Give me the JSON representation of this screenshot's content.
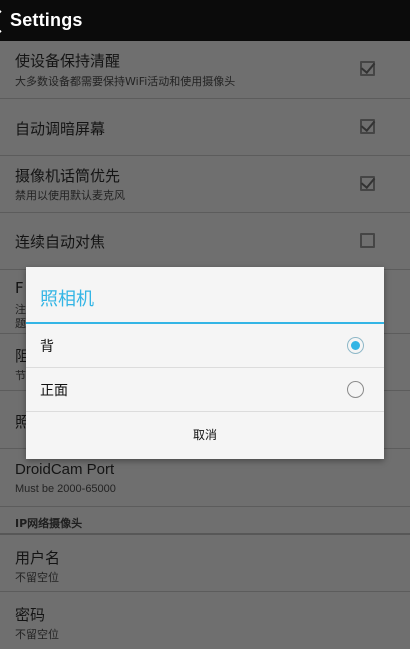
{
  "actionbar": {
    "title": "Settings"
  },
  "settings": {
    "keep_awake": {
      "title": "使设备保持清醒",
      "summary": "大多数设备都需要保持WiFi活动和使用摄像头",
      "checked": true
    },
    "auto_dim": {
      "title": "自动调暗屏幕",
      "checked": true
    },
    "camera_mic": {
      "title": "摄像机话筒优先",
      "summary": "禁用以使用默认麦克风",
      "checked": true
    },
    "continuous_focus": {
      "title": "连续自动对焦",
      "checked": false
    },
    "partial_row_1": {
      "title_fragment": "F",
      "summary_line1_fragment": "注",
      "summary_line2_fragment": "题"
    },
    "partial_row_2": {
      "title_fragment": "阻",
      "summary_fragment": "节"
    },
    "partial_row_3": {
      "title_fragment": "照"
    },
    "port": {
      "title": "DroidCam Port",
      "summary": "Must be 2000-65000"
    },
    "ip_category": "IP网络摄像头",
    "username": {
      "title": "用户名",
      "summary": "不留空位"
    },
    "password": {
      "title": "密码",
      "summary": "不留空位"
    }
  },
  "dialog": {
    "title": "照相机",
    "options": [
      {
        "label": "背",
        "selected": true
      },
      {
        "label": "正面",
        "selected": false
      }
    ],
    "cancel_label": "取消"
  },
  "colors": {
    "accent": "#33b5e5",
    "actionbar": "#0b0b0b",
    "dim_background": "#6f6f6f"
  }
}
